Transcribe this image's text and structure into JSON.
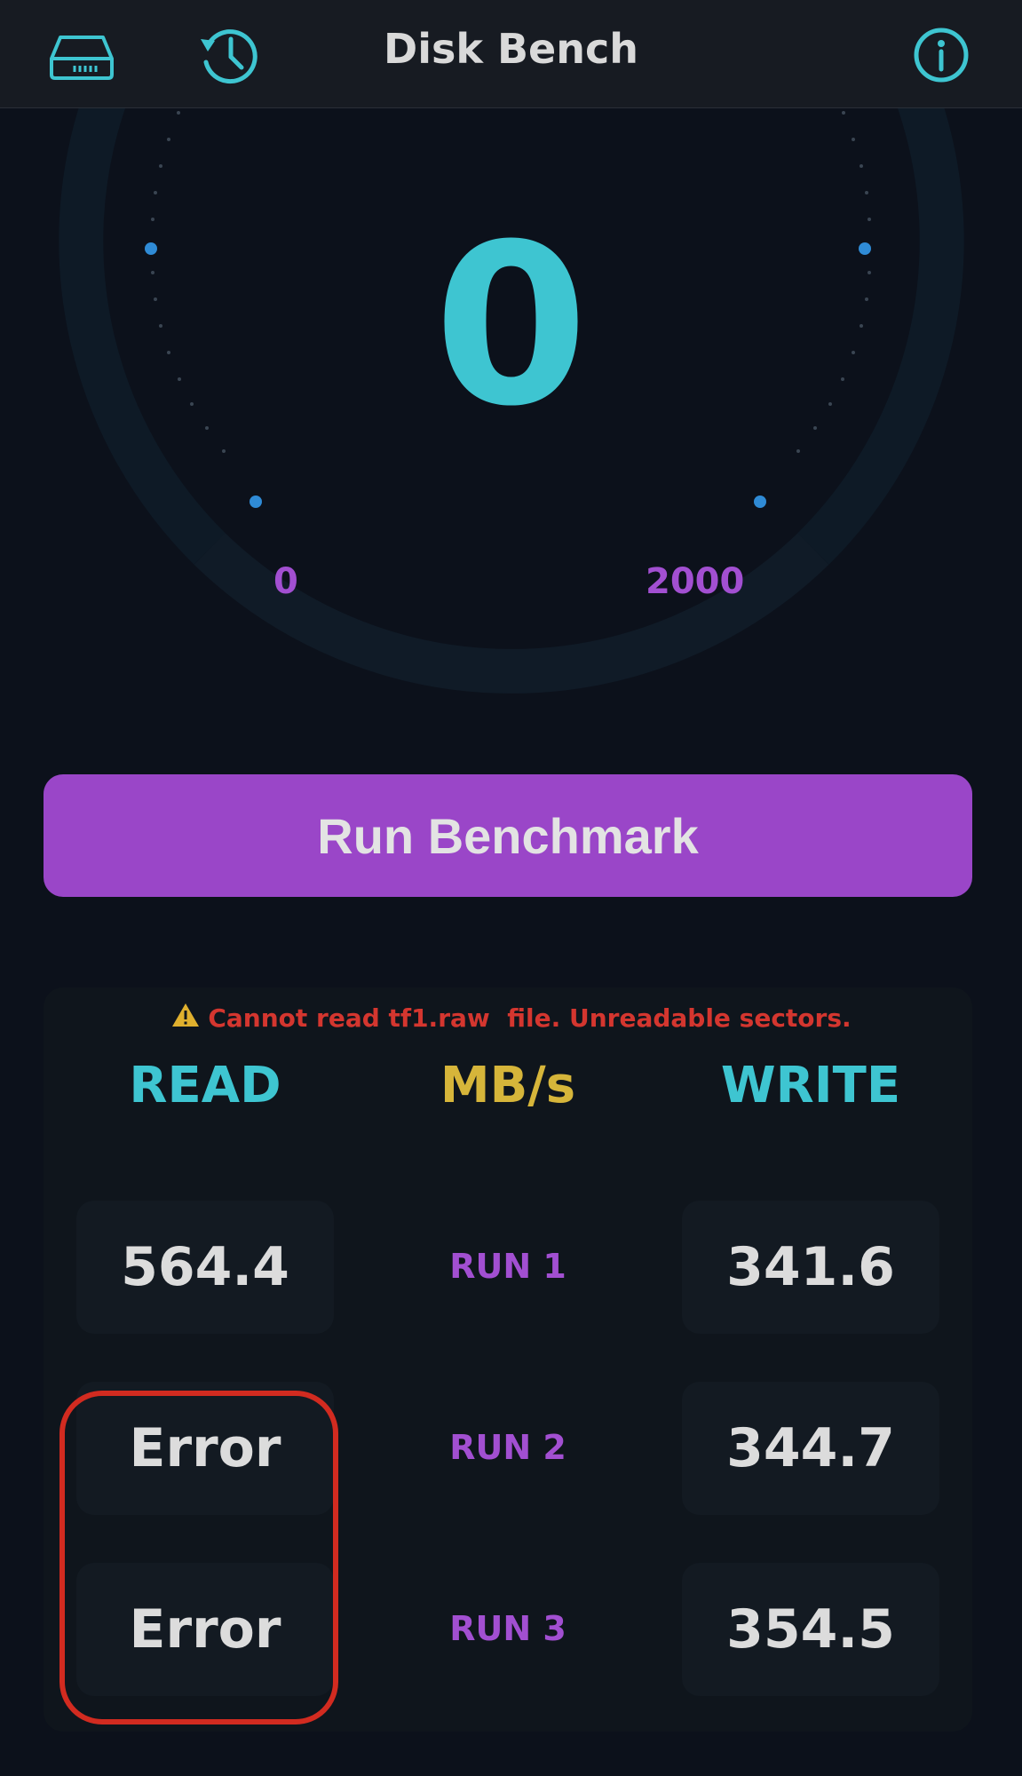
{
  "header": {
    "title": "Disk Bench",
    "icons": {
      "left_1": "disk-drive-icon",
      "left_2": "history-icon",
      "right": "info-icon"
    }
  },
  "gauge": {
    "value": "0",
    "min_label": "0",
    "max_label": "2000"
  },
  "actions": {
    "run_label": "Run Benchmark"
  },
  "results": {
    "warning_icon": "warning-icon",
    "warning_text": "Cannot read tf1.raw  file. Unreadable sectors.",
    "headers": {
      "read": "READ",
      "unit": "MB/s",
      "write": "WRITE"
    },
    "runs": [
      {
        "label": "RUN 1",
        "read": "564.4",
        "write": "341.6"
      },
      {
        "label": "RUN 2",
        "read": "Error",
        "write": "344.7"
      },
      {
        "label": "RUN 3",
        "read": "Error",
        "write": "354.5"
      }
    ]
  },
  "colors": {
    "background": "#0c111b",
    "accent_cyan": "#3ec5d1",
    "accent_purple": "#9a46c8",
    "unit_yellow": "#d6b53a",
    "error_red": "#d22b20"
  }
}
